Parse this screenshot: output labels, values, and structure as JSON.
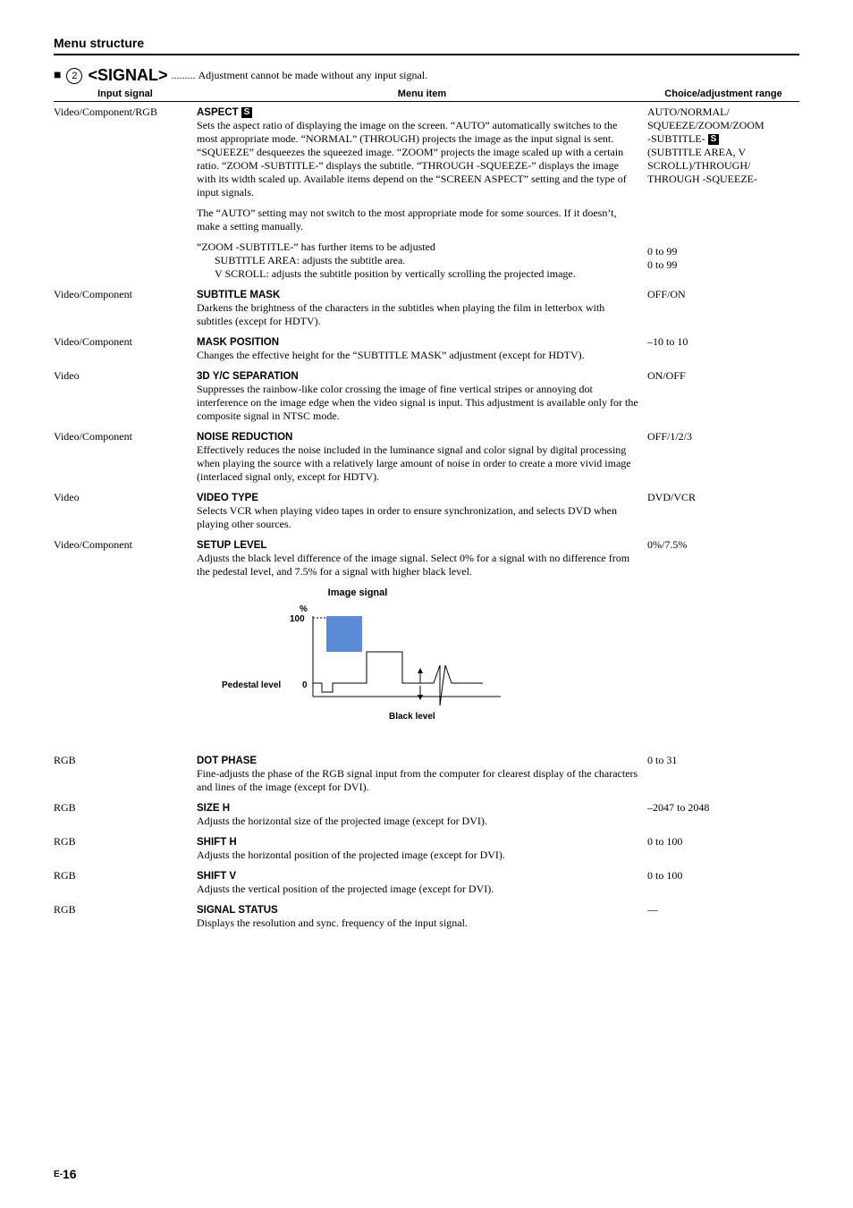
{
  "header": "Menu structure",
  "signal": {
    "title": "<SIGNAL>",
    "dots": ".........",
    "desc": "Adjustment cannot be made without any input signal."
  },
  "cols": {
    "input": "Input signal",
    "menu": "Menu item",
    "choice": "Choice/adjustment range"
  },
  "aspect": {
    "input": "Video/Component/RGB",
    "label": "ASPECT",
    "p1": "Sets the aspect ratio of displaying the image on the screen. “AUTO” automatically switches to the most appropriate mode. “NORMAL” (THROUGH) projects the image as the input signal is sent. “SQUEEZE” desqueezes the squeezed image. “ZOOM” projects the image scaled up with a certain ratio. “ZOOM -SUBTITLE-” displays the subtitle. “THROUGH -SQUEEZE-” displays the image with its width scaled up. Available items depend on the “SCREEN ASPECT” setting and the type of input signals.",
    "p2": "The “AUTO” setting may not switch to the most appropriate mode for some sources. If it doesn’t, make a setting manually.",
    "p3": "“ZOOM -SUBTITLE-” has further items to be adjusted",
    "sub1": "SUBTITLE AREA: adjusts the subtitle area.",
    "sub2": "V SCROLL: adjusts the subtitle position by vertically scrolling the projected image.",
    "choice_a": "AUTO/NORMAL/",
    "choice_b": "SQUEEZE/ZOOM/ZOOM",
    "choice_c_pre": "-SUBTITLE- ",
    "choice_d": "(SUBTITLE AREA, V",
    "choice_e": "SCROLL)/THROUGH/",
    "choice_f": "THROUGH -SQUEEZE-",
    "sub1_choice": "0 to 99",
    "sub2_choice": "0 to 99"
  },
  "subtitle_mask": {
    "input": "Video/Component",
    "label": "SUBTITLE MASK",
    "desc": "Darkens the brightness of the characters in the subtitles when playing the film in letterbox with subtitles (except for HDTV).",
    "choice": "OFF/ON"
  },
  "mask_position": {
    "input": "Video/Component",
    "label": "MASK POSITION",
    "desc": "Changes the effective height for the “SUBTITLE MASK” adjustment (except for HDTV).",
    "choice": "–10 to 10"
  },
  "yc_sep": {
    "input": "Video",
    "label": "3D Y/C SEPARATION",
    "desc": "Suppresses the rainbow-like color crossing the image of fine vertical stripes or annoying dot interference on the image edge when the video signal is input. This adjustment is available only for the composite signal in NTSC mode.",
    "choice": "ON/OFF"
  },
  "noise": {
    "input": "Video/Component",
    "label": "NOISE REDUCTION",
    "desc": "Effectively reduces the noise included in the luminance signal and color signal by digital processing when playing the source with a relatively large amount of noise in order to create a more vivid image (interlaced signal only, except for HDTV).",
    "choice": "OFF/1/2/3"
  },
  "videotype": {
    "input": "Video",
    "label": "VIDEO TYPE",
    "desc": "Selects VCR when playing video tapes in order to ensure synchronization, and selects DVD when playing other sources.",
    "choice": "DVD/VCR"
  },
  "setup": {
    "input": "Video/Component",
    "label": "SETUP LEVEL",
    "desc": "Adjusts the black level difference of the image signal. Select 0% for a signal with no difference from the pedestal level, and 7.5% for a signal with higher black level.",
    "choice": "0%/7.5%"
  },
  "diagram": {
    "title": "Image signal",
    "percent": "%",
    "hundred": "100",
    "zero": "0",
    "pedestal": "Pedestal level",
    "black": "Black level"
  },
  "dotphase": {
    "input": "RGB",
    "label": "DOT PHASE",
    "desc": "Fine-adjusts the phase of the RGB signal input from the computer for clearest display of the characters and lines of the image (except for DVI).",
    "choice": "0 to 31"
  },
  "sizeh": {
    "input": "RGB",
    "label": "SIZE H",
    "desc": "Adjusts the horizontal size of the projected image (except for DVI).",
    "choice": "–2047 to 2048"
  },
  "shifth": {
    "input": "RGB",
    "label": "SHIFT H",
    "desc": "Adjusts the horizontal position of the projected image (except for DVI).",
    "choice": "0 to 100"
  },
  "shiftv": {
    "input": "RGB",
    "label": "SHIFT V",
    "desc": "Adjusts the vertical position of the projected image (except for DVI).",
    "choice": "0 to 100"
  },
  "status": {
    "input": "RGB",
    "label": "SIGNAL STATUS",
    "desc": "Displays the resolution and sync. frequency of the input signal.",
    "choice": "—"
  },
  "page": {
    "e": "E-",
    "num": "16"
  }
}
